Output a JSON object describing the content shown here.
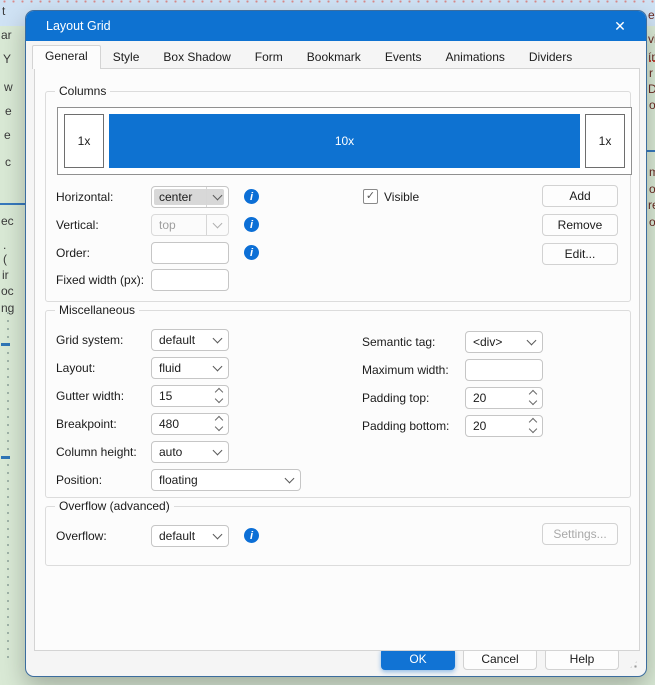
{
  "window": {
    "title": "Layout Grid"
  },
  "icons": {
    "info": "i",
    "close": "✕",
    "check": "✓"
  },
  "tabs": [
    {
      "label": "General",
      "selected": true
    },
    {
      "label": "Style",
      "selected": false
    },
    {
      "label": "Box Shadow",
      "selected": false
    },
    {
      "label": "Form",
      "selected": false
    },
    {
      "label": "Bookmark",
      "selected": false
    },
    {
      "label": "Events",
      "selected": false
    },
    {
      "label": "Animations",
      "selected": false
    },
    {
      "label": "Dividers",
      "selected": false
    }
  ],
  "columns_group": {
    "title": "Columns",
    "preview": [
      {
        "label": "1x",
        "selected": false
      },
      {
        "label": "10x",
        "selected": true
      },
      {
        "label": "1x",
        "selected": false
      }
    ],
    "horizontal": {
      "label": "Horizontal:",
      "value": "center"
    },
    "vertical": {
      "label": "Vertical:",
      "value": "top",
      "disabled": true
    },
    "order": {
      "label": "Order:",
      "value": ""
    },
    "fixed_width": {
      "label": "Fixed width (px):",
      "value": ""
    },
    "visible_checkbox": {
      "label": "Visible",
      "checked": true
    },
    "buttons": {
      "add": "Add",
      "remove": "Remove",
      "edit": "Edit..."
    }
  },
  "misc_group": {
    "title": "Miscellaneous",
    "grid_system": {
      "label": "Grid system:",
      "value": "default"
    },
    "layout": {
      "label": "Layout:",
      "value": "fluid"
    },
    "gutter_width": {
      "label": "Gutter width:",
      "value": "15"
    },
    "breakpoint": {
      "label": "Breakpoint:",
      "value": "480"
    },
    "column_height": {
      "label": "Column height:",
      "value": "auto"
    },
    "position": {
      "label": "Position:",
      "value": "floating"
    },
    "semantic_tag": {
      "label": "Semantic tag:",
      "value": "<div>"
    },
    "maximum_width": {
      "label": "Maximum width:",
      "value": ""
    },
    "padding_top": {
      "label": "Padding top:",
      "value": "20"
    },
    "padding_bottom": {
      "label": "Padding bottom:",
      "value": "20"
    }
  },
  "overflow_group": {
    "title": "Overflow (advanced)",
    "overflow": {
      "label": "Overflow:",
      "value": "default"
    },
    "settings_button": {
      "label": "Settings...",
      "disabled": true
    }
  },
  "footer": {
    "ok": "OK",
    "cancel": "Cancel",
    "help": "Help"
  },
  "colors": {
    "accent": "#0e72d1",
    "titlebar": "#0e72d1",
    "selected_column": "#0e72d1",
    "info_icon": "#0c6fd6",
    "page_bg": "#d9e9d5"
  },
  "background": {
    "left_fragments": [
      "t",
      "ar",
      "Y",
      "w",
      "e",
      "e",
      "c",
      "ec",
      ".",
      "(",
      "ir",
      "oc",
      "ng"
    ],
    "right_fragments": [
      "e",
      "vi",
      "ín",
      "r",
      "D",
      "o",
      "m",
      "o",
      "re",
      "o"
    ]
  }
}
